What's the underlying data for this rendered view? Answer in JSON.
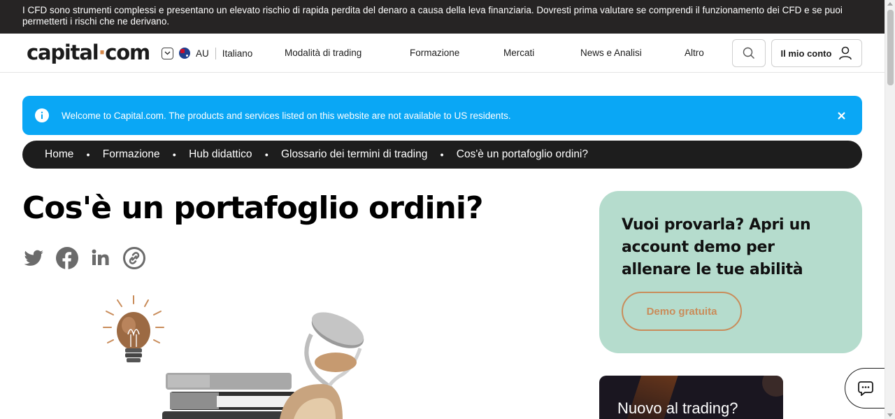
{
  "risk_warning": "I CFD sono strumenti complessi e presentano un elevato rischio di rapida perdita del denaro a causa della leva finanziaria. Dovresti prima valutare se comprendi il funzionamento dei CFD e se puoi permetterti i rischi che ne derivano.",
  "header": {
    "logo_left": "capital",
    "logo_dot": "·",
    "logo_right": "com",
    "region_code": "AU",
    "language": "Italiano",
    "nav": [
      "Modalità di trading",
      "Formazione",
      "Mercati",
      "News e Analisi",
      "Altro"
    ],
    "account_label": "Il mio conto"
  },
  "banner": {
    "message": "Welcome to Capital.com. The products and services listed on this website are not available to US residents.",
    "color": "#0aa7f5"
  },
  "breadcrumb": [
    "Home",
    "Formazione",
    "Hub didattico",
    "Glossario dei termini di trading",
    "Cos'è un portafoglio ordini?"
  ],
  "page": {
    "title": "Cos'è un portafoglio ordini?",
    "share_icons": [
      "twitter-icon",
      "facebook-icon",
      "linkedin-icon",
      "copy-link-icon"
    ]
  },
  "demo_card": {
    "heading": "Vuoi provarla? Apri un account demo per allenare le tue abilità",
    "button": "Demo gratuita",
    "bg_color": "#b5dccd",
    "accent_color": "#c98c5a"
  },
  "new_card": {
    "heading": "Nuovo al trading?"
  },
  "chat": {
    "icon": "chat-icon"
  }
}
